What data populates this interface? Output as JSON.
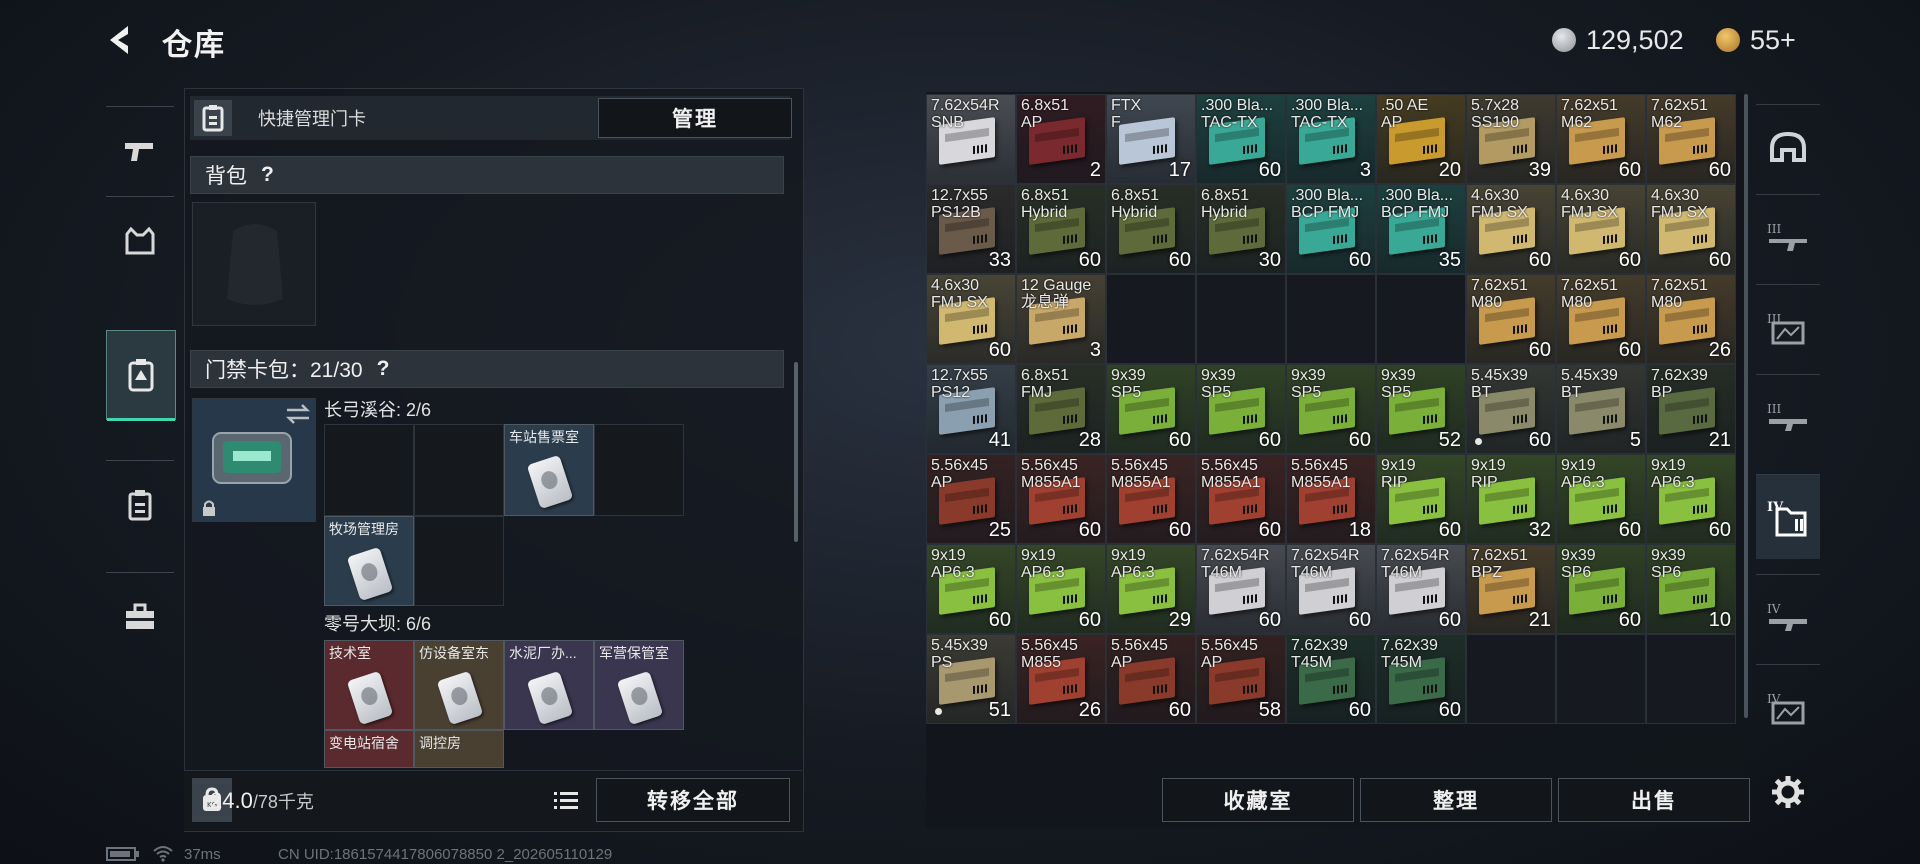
{
  "header": {
    "title": "仓库",
    "currency_main": "129,502",
    "currency_premium": "55+"
  },
  "colors": {
    "accent_teal": "#3fd6b0",
    "coin_silver": "#b8bcc2",
    "coin_gold": "#d9a441"
  },
  "left_tabs": [
    {
      "icon": "pistol-icon"
    },
    {
      "icon": "armor-vest-icon"
    },
    {
      "icon": "keycard-wallet-icon",
      "active": true
    },
    {
      "icon": "clipboard-icon"
    },
    {
      "icon": "toolbox-icon"
    }
  ],
  "quick_manage": {
    "label": "快捷管理门卡",
    "button": "管理"
  },
  "backpack": {
    "title": "背包",
    "help": "?"
  },
  "card_pack": {
    "title": "门禁卡包：21/30",
    "help": "?",
    "groups": [
      {
        "title": "长弓溪谷: 2/6",
        "cards": [
          "车站售票室",
          "牧场管理房"
        ]
      },
      {
        "title": "零号大坝: 6/6",
        "cards": [
          "技术室",
          "仿设备室东",
          "水泥厂办...",
          "军营保管室",
          "变电站宿舍",
          "调控房"
        ]
      }
    ]
  },
  "footer": {
    "weight_current": "24.0",
    "weight_max": "/78千克",
    "transfer_button": "转移全部"
  },
  "inventory": {
    "rows": [
      [
        {
          "name": "7.62x54R\nSNB",
          "count": "",
          "color": "#d8d8dc"
        },
        {
          "name": "6.8x51\nAP",
          "count": "2",
          "color": "#7a2a2e"
        },
        {
          "name": "FTX\nF",
          "count": "17",
          "color": "#b8c6d8"
        },
        {
          "name": ".300 Bla...\nTAC-TX",
          "count": "60",
          "color": "#3aa896"
        },
        {
          "name": ".300 Bla...\nTAC-TX",
          "count": "3",
          "color": "#3aa896"
        },
        {
          "name": ".50 AE\nAP",
          "count": "20",
          "color": "#c99a2e"
        },
        {
          "name": "5.7x28\nSS190",
          "count": "39",
          "color": "#b29a62"
        },
        {
          "name": "7.62x51\nM62",
          "count": "60",
          "color": "#c79a4e"
        },
        {
          "name": "7.62x51\nM62",
          "count": "60",
          "color": "#c79a4e"
        }
      ],
      [
        {
          "name": "12.7x55\nPS12B",
          "count": "33",
          "color": "#6a5a4a"
        },
        {
          "name": "6.8x51\nHybrid",
          "count": "60",
          "color": "#5e6a3a"
        },
        {
          "name": "6.8x51\nHybrid",
          "count": "60",
          "color": "#5e6a3a"
        },
        {
          "name": "6.8x51\nHybrid",
          "count": "30",
          "color": "#5e6a3a"
        },
        {
          "name": ".300 Bla...\nBCP FMJ",
          "count": "60",
          "color": "#3aa896"
        },
        {
          "name": ".300 Bla...\nBCP FMJ",
          "count": "35",
          "color": "#3aa896"
        },
        {
          "name": "4.6x30\nFMJ SX",
          "count": "60",
          "color": "#d0b870"
        },
        {
          "name": "4.6x30\nFMJ SX",
          "count": "60",
          "color": "#d0b870"
        },
        {
          "name": "4.6x30\nFMJ SX",
          "count": "60",
          "color": "#d0b870"
        }
      ],
      [
        {
          "name": "4.6x30\nFMJ SX",
          "count": "60",
          "color": "#d0b870"
        },
        {
          "name": "12 Gauge\n龙息弹",
          "count": "3",
          "color": "#c8a868"
        },
        null,
        null,
        null,
        null,
        {
          "name": "7.62x51\nM80",
          "count": "60",
          "color": "#c79a4e"
        },
        {
          "name": "7.62x51\nM80",
          "count": "60",
          "color": "#c79a4e"
        },
        {
          "name": "7.62x51\nM80",
          "count": "26",
          "color": "#c79a4e"
        }
      ],
      [
        {
          "name": "12.7x55\nPS12",
          "count": "41",
          "color": "#8aa0b0"
        },
        {
          "name": "6.8x51\nFMJ",
          "count": "28",
          "color": "#5e6a3a"
        },
        {
          "name": "9x39\nSP5",
          "count": "60",
          "color": "#7ab03a"
        },
        {
          "name": "9x39\nSP5",
          "count": "60",
          "color": "#7ab03a"
        },
        {
          "name": "9x39\nSP5",
          "count": "60",
          "color": "#7ab03a"
        },
        {
          "name": "9x39\nSP5",
          "count": "52",
          "color": "#7ab03a"
        },
        {
          "name": "5.45x39\nBT",
          "count": "60",
          "color": "#8a8a6a",
          "dot": true
        },
        {
          "name": "5.45x39\nBT",
          "count": "5",
          "color": "#8a8a6a"
        },
        {
          "name": "7.62x39\nBP",
          "count": "21",
          "color": "#5a6a40"
        }
      ],
      [
        {
          "name": "5.56x45\nAP",
          "count": "25",
          "color": "#8a3a2a"
        },
        {
          "name": "5.56x45\nM855A1",
          "count": "60",
          "color": "#a04030"
        },
        {
          "name": "5.56x45\nM855A1",
          "count": "60",
          "color": "#a04030"
        },
        {
          "name": "5.56x45\nM855A1",
          "count": "60",
          "color": "#a04030"
        },
        {
          "name": "5.56x45\nM855A1",
          "count": "18",
          "color": "#a04030"
        },
        {
          "name": "9x19\nRIP",
          "count": "60",
          "color": "#8ac040"
        },
        {
          "name": "9x19\nRIP",
          "count": "32",
          "color": "#8ac040"
        },
        {
          "name": "9x19\nAP6.3",
          "count": "60",
          "color": "#8ac040"
        },
        {
          "name": "9x19\nAP6.3",
          "count": "60",
          "color": "#8ac040"
        }
      ],
      [
        {
          "name": "9x19\nAP6.3",
          "count": "60",
          "color": "#8ac040"
        },
        {
          "name": "9x19\nAP6.3",
          "count": "60",
          "color": "#8ac040"
        },
        {
          "name": "9x19\nAP6.3",
          "count": "29",
          "color": "#8ac040"
        },
        {
          "name": "7.62x54R\nT46M",
          "count": "60",
          "color": "#d0d0d4"
        },
        {
          "name": "7.62x54R\nT46M",
          "count": "60",
          "color": "#d0d0d4"
        },
        {
          "name": "7.62x54R\nT46M",
          "count": "60",
          "color": "#d0d0d4"
        },
        {
          "name": "7.62x51\nBPZ",
          "count": "21",
          "color": "#c79a4e"
        },
        {
          "name": "9x39\nSP6",
          "count": "60",
          "color": "#7ab03a"
        },
        {
          "name": "9x39\nSP6",
          "count": "10",
          "color": "#7ab03a"
        }
      ],
      [
        {
          "name": "5.45x39\nPS",
          "count": "51",
          "color": "#a89870",
          "dot": true
        },
        {
          "name": "5.56x45\nM855",
          "count": "26",
          "color": "#a04030"
        },
        {
          "name": "5.56x45\nAP",
          "count": "60",
          "color": "#8a3a2a"
        },
        {
          "name": "5.56x45\nAP",
          "count": "58",
          "color": "#8a3a2a"
        },
        {
          "name": "7.62x39\nT45M",
          "count": "60",
          "color": "#3a6a48"
        },
        {
          "name": "7.62x39\nT45M",
          "count": "60",
          "color": "#3a6a48"
        },
        null,
        null,
        null
      ]
    ],
    "buttons": {
      "collection": "收藏室",
      "sort": "整理",
      "sell": "出售"
    }
  },
  "right_tabs": [
    {
      "icon": "helmet-icon"
    },
    {
      "icon": "tier3-rifle-icon"
    },
    {
      "icon": "tier3-map-icon"
    },
    {
      "icon": "tier3-weapon-icon"
    },
    {
      "icon": "tier4-folder-icon",
      "active": true
    },
    {
      "icon": "tier4-weapon-icon"
    },
    {
      "icon": "tier4-map-icon"
    },
    {
      "icon": "settings-gear-icon"
    }
  ],
  "status_bar": {
    "ping": "37ms",
    "uid": "CN UID:1861574417806078850 2_202605110129"
  }
}
